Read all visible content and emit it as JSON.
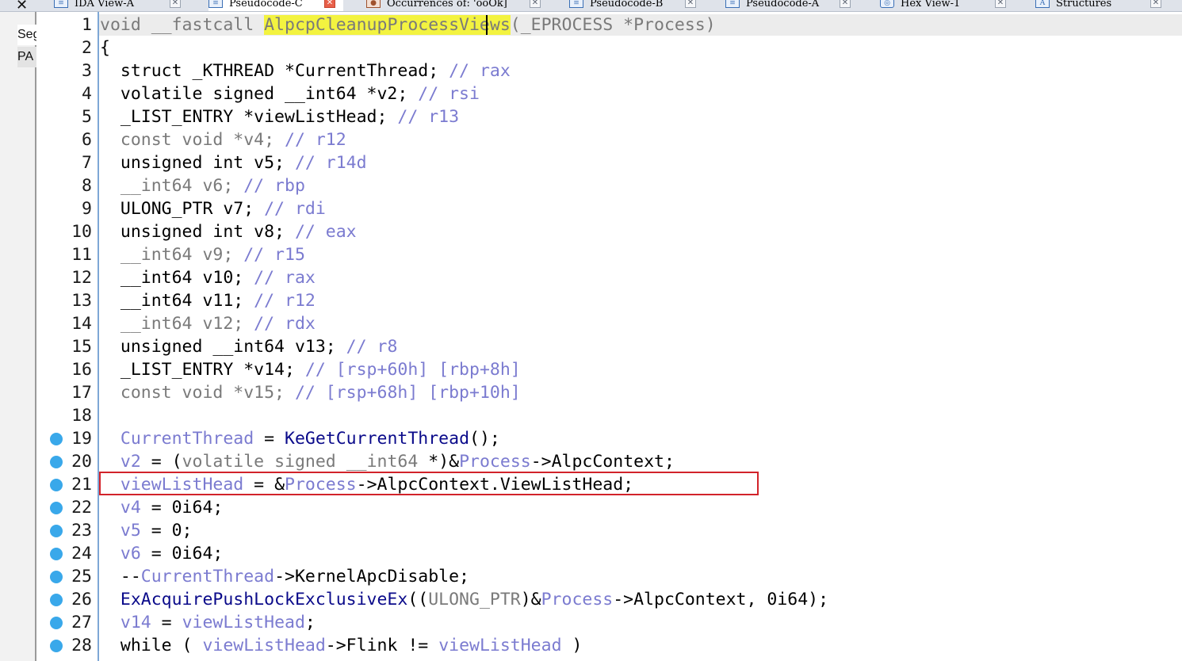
{
  "tabs": [
    {
      "label": "IDA View-A",
      "icon": "disassembly-icon",
      "active": false
    },
    {
      "label": "Pseudocode-C",
      "icon": "pseudocode-icon",
      "active": true
    },
    {
      "label": "Occurrences of: 'ooOk]",
      "icon": "occurrences-icon",
      "active": false
    },
    {
      "label": "Pseudocode-B",
      "icon": "pseudocode-icon",
      "active": false
    },
    {
      "label": "Pseudocode-A",
      "icon": "pseudocode-icon",
      "active": false
    },
    {
      "label": "Hex View-1",
      "icon": "hex-view-icon",
      "active": false
    },
    {
      "label": "Structures",
      "icon": "structures-icon",
      "active": false
    }
  ],
  "side_panel": {
    "items": [
      "Seg",
      "PA"
    ]
  },
  "colors": {
    "function_name_highlight": "#f3f340",
    "breakpoint_dot": "#39a8ea",
    "selection_box": "#d2232a",
    "comment_and_variable": "#7b7bd0"
  },
  "editor": {
    "lines": [
      {
        "n": "1",
        "text": "void __fastcall AlpcpCleanupProcessViews(_EPROCESS *Process)",
        "bp": false
      },
      {
        "n": "2",
        "text": "{",
        "bp": false
      },
      {
        "n": "3",
        "text": "  struct _KTHREAD *CurrentThread; // rax",
        "bp": false
      },
      {
        "n": "4",
        "text": "  volatile signed __int64 *v2; // rsi",
        "bp": false
      },
      {
        "n": "5",
        "text": "  _LIST_ENTRY *viewListHead; // r13",
        "bp": false
      },
      {
        "n": "6",
        "text": "  const void *v4; // r12",
        "bp": false
      },
      {
        "n": "7",
        "text": "  unsigned int v5; // r14d",
        "bp": false
      },
      {
        "n": "8",
        "text": "  __int64 v6; // rbp",
        "bp": false
      },
      {
        "n": "9",
        "text": "  ULONG_PTR v7; // rdi",
        "bp": false
      },
      {
        "n": "10",
        "text": "  unsigned int v8; // eax",
        "bp": false
      },
      {
        "n": "11",
        "text": "  __int64 v9; // r15",
        "bp": false
      },
      {
        "n": "12",
        "text": "  __int64 v10; // rax",
        "bp": false
      },
      {
        "n": "13",
        "text": "  __int64 v11; // r12",
        "bp": false
      },
      {
        "n": "14",
        "text": "  __int64 v12; // rdx",
        "bp": false
      },
      {
        "n": "15",
        "text": "  unsigned __int64 v13; // r8",
        "bp": false
      },
      {
        "n": "16",
        "text": "  _LIST_ENTRY *v14; // [rsp+60h] [rbp+8h]",
        "bp": false
      },
      {
        "n": "17",
        "text": "  const void *v15; // [rsp+68h] [rbp+10h]",
        "bp": false
      },
      {
        "n": "18",
        "text": "",
        "bp": false
      },
      {
        "n": "19",
        "text": "  CurrentThread = KeGetCurrentThread();",
        "bp": true
      },
      {
        "n": "20",
        "text": "  v2 = (volatile signed __int64 *)&Process->AlpcContext;",
        "bp": true
      },
      {
        "n": "21",
        "text": "  viewListHead = &Process->AlpcContext.ViewListHead;",
        "bp": true
      },
      {
        "n": "22",
        "text": "  v4 = 0i64;",
        "bp": true
      },
      {
        "n": "23",
        "text": "  v5 = 0;",
        "bp": true
      },
      {
        "n": "24",
        "text": "  v6 = 0i64;",
        "bp": true
      },
      {
        "n": "25",
        "text": "  --CurrentThread->KernelApcDisable;",
        "bp": true
      },
      {
        "n": "26",
        "text": "  ExAcquirePushLockExclusiveEx((ULONG_PTR)&Process->AlpcContext, 0i64);",
        "bp": true
      },
      {
        "n": "27",
        "text": "  v14 = viewListHead;",
        "bp": true
      },
      {
        "n": "28",
        "text": "  while ( viewListHead->Flink != viewListHead )",
        "bp": true
      }
    ]
  }
}
